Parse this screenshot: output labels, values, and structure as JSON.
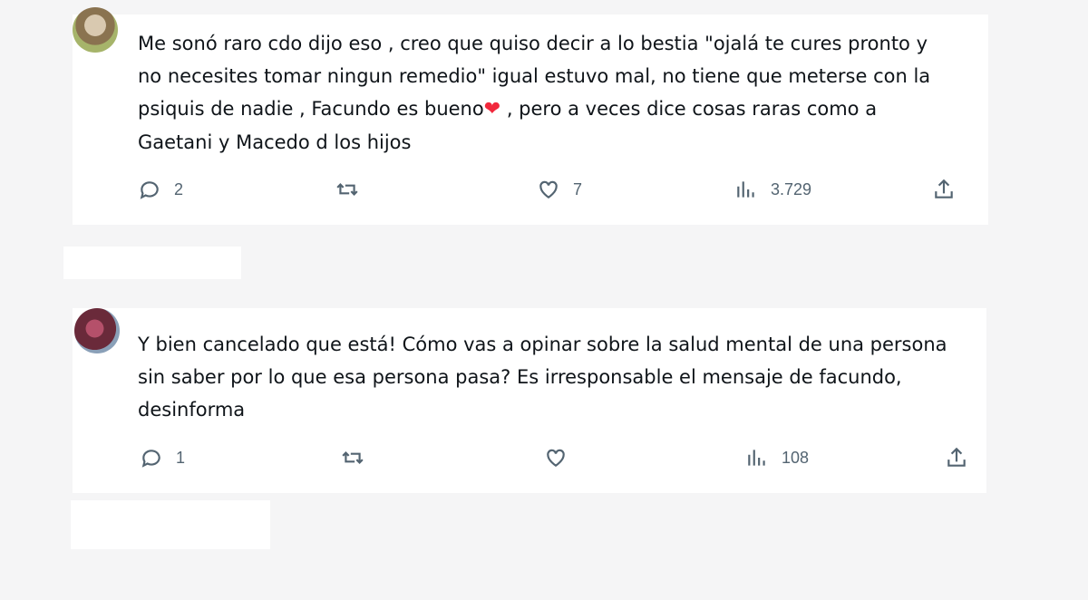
{
  "tweets": [
    {
      "header": {
        "name": "",
        "handle": ""
      },
      "text_part1": "Me sonó raro cdo dijo eso , creo que quiso decir a lo bestia \"ojalá te cures pronto y no necesites tomar ningun remedio\" igual estuvo mal, no tiene que meterse con la psiquis de nadie , Facundo es bueno",
      "heart": "❤",
      "text_part2": " , pero a veces dice cosas raras como a Gaetani y Macedo d los hijos",
      "replies": "2",
      "retweets": "",
      "likes": "7",
      "views": "3.729"
    },
    {
      "header": {
        "name": "",
        "handle": ""
      },
      "text_part1": "Y bien cancelado que está! Cómo vas a opinar sobre la salud mental de una persona sin saber por lo que esa persona pasa? Es irresponsable el mensaje de facundo, desinforma",
      "replies": "1",
      "retweets": "",
      "likes": "",
      "views": "108"
    }
  ],
  "icons": {
    "reply": "reply-icon",
    "retweet": "retweet-icon",
    "like": "heart-icon",
    "views": "views-chart-icon",
    "share": "share-icon"
  },
  "colors": {
    "muted": "#536471",
    "heart_red": "#f1283c",
    "text": "#0f1419"
  }
}
